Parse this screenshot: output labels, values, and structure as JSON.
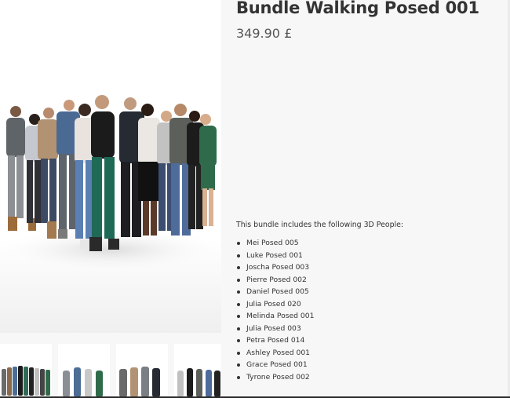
{
  "product": {
    "title": "Bundle Walking Posed 001",
    "price": "349.90 £"
  },
  "description": {
    "intro": "This bundle includes the following 3D People:",
    "people": [
      "Mei Posed 005",
      "Luke Posed 001",
      "Joscha Posed 003",
      "Pierre Posed 002",
      "Daniel Posed 005",
      "Julia Posed 020",
      "Melinda Posed 001",
      "Julia Posed 003",
      "Petra Posed 014",
      "Ashley Posed 001",
      "Grace Posed 001",
      "Tyrone Posed 002"
    ]
  },
  "gallery": {
    "thumbnail_count": 4
  }
}
